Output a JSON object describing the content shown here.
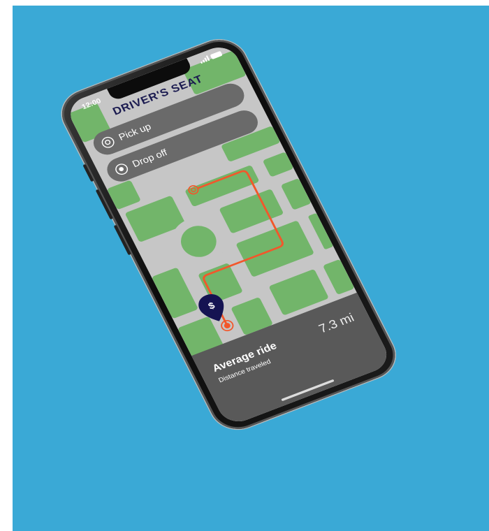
{
  "status_bar": {
    "time": "12:00"
  },
  "app": {
    "title": "DRIVER'S SEAT"
  },
  "locations": {
    "pickup_label": "Pick up",
    "dropoff_label": "Drop off"
  },
  "marker": {
    "symbol": "$"
  },
  "ride": {
    "title": "Average ride",
    "subtitle": "Distance traveled",
    "distance": "7.3 mi"
  },
  "colors": {
    "background": "#3aa9d6",
    "map_green": "#72b56a",
    "road": "#c6c6c6",
    "route": "#f2572b",
    "title_navy": "#1b1b50",
    "pin_navy": "#151352",
    "bottom_panel": "#595959"
  }
}
